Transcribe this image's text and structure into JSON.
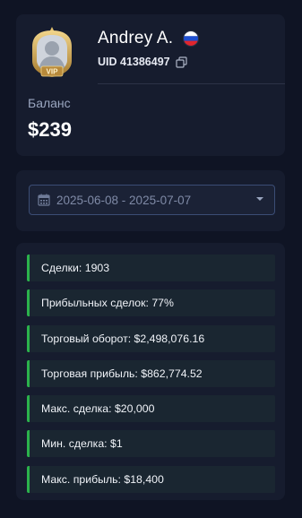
{
  "profile": {
    "badge": "VIP",
    "name": "Andrey A.",
    "flag_country": "RU",
    "uid": "UID 41386497",
    "balance_label": "Баланс",
    "balance_value": "$239"
  },
  "date_filter": {
    "range": "2025-06-08 - 2025-07-07"
  },
  "stats": [
    "Сделки: 1903",
    "Прибыльных сделок: 77%",
    "Торговый оборот: $2,498,076.16",
    "Торговая прибыль: $862,774.52",
    "Макс. сделка: $20,000",
    "Мин. сделка: $1",
    "Макс. прибыль: $18,400"
  ],
  "colors": {
    "background": "#0f1424",
    "card": "#161c2e",
    "stat_row": "#1a2631",
    "accent_green": "#2bb24c",
    "badge_gold": "#d9b15a"
  }
}
